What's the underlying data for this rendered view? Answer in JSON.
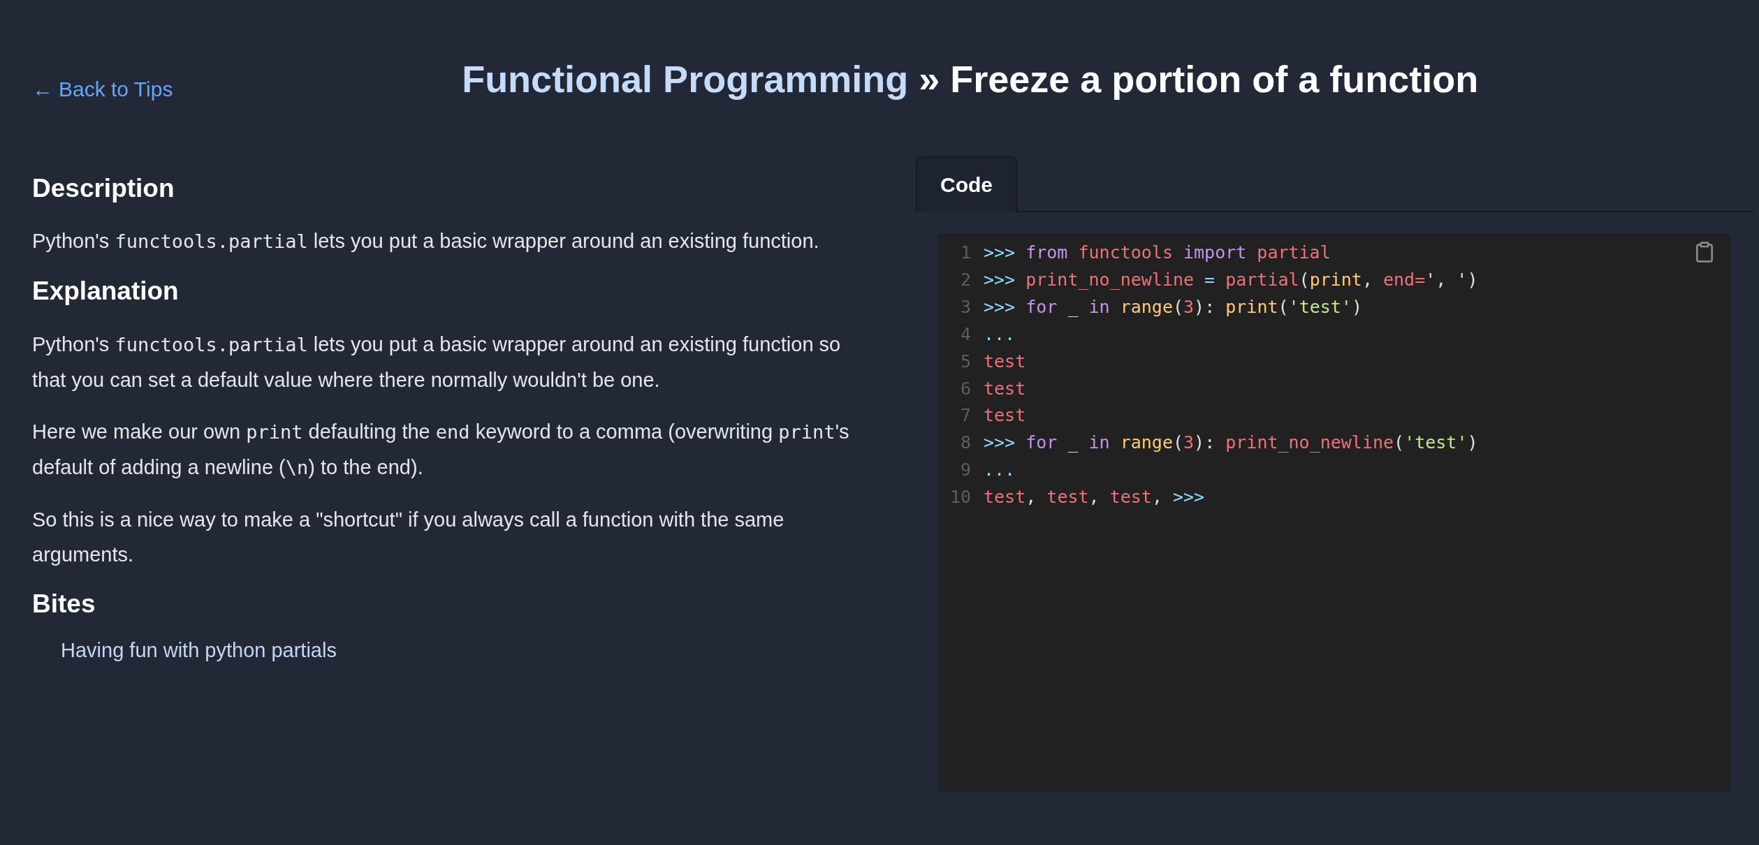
{
  "back_link": {
    "arrow": "←",
    "label": "Back to Tips"
  },
  "title": {
    "category": "Functional Programming",
    "separator": " » ",
    "name": "Freeze a portion of a function"
  },
  "sections": [
    {
      "heading": "Description",
      "paragraphs": [
        [
          {
            "kind": "text",
            "text": "Python's "
          },
          {
            "kind": "code",
            "text": "functools.partial"
          },
          {
            "kind": "text",
            "text": " lets you put a basic wrapper around an existing function."
          }
        ]
      ]
    },
    {
      "heading": "Explanation",
      "paragraphs": [
        [
          {
            "kind": "text",
            "text": "Python's "
          },
          {
            "kind": "code",
            "text": "functools.partial"
          },
          {
            "kind": "text",
            "text": " lets you put a basic wrapper around an existing function so that you can set a default value where there normally wouldn't be one."
          }
        ],
        [
          {
            "kind": "text",
            "text": "Here we make our own "
          },
          {
            "kind": "code",
            "text": "print"
          },
          {
            "kind": "text",
            "text": " defaulting the "
          },
          {
            "kind": "code",
            "text": "end"
          },
          {
            "kind": "text",
            "text": " keyword to a comma (overwriting "
          },
          {
            "kind": "code",
            "text": "print"
          },
          {
            "kind": "text",
            "text": "'s default of adding a newline ("
          },
          {
            "kind": "code",
            "text": "\\n"
          },
          {
            "kind": "text",
            "text": ") to the end)."
          }
        ],
        [
          {
            "kind": "text",
            "text": "So this is a nice way to make a \"shortcut\" if you always call a function with the same arguments."
          }
        ]
      ]
    }
  ],
  "bites": {
    "heading": "Bites",
    "links": [
      "Having fun with python partials"
    ]
  },
  "tabs": [
    {
      "label": "Code",
      "selected": true
    }
  ],
  "code_lines": [
    {
      "n": "1",
      "tokens": [
        {
          "kind": "prompt",
          "text": ">>> "
        },
        {
          "kind": "keyword",
          "text": "from "
        },
        {
          "kind": "name",
          "text": "functools "
        },
        {
          "kind": "keyword",
          "text": "import "
        },
        {
          "kind": "name",
          "text": "partial"
        }
      ]
    },
    {
      "n": "2",
      "tokens": [
        {
          "kind": "prompt",
          "text": ">>> "
        },
        {
          "kind": "name",
          "text": "print_no_newline "
        },
        {
          "kind": "operator",
          "text": "= "
        },
        {
          "kind": "name",
          "text": "partial"
        },
        {
          "kind": "punct",
          "text": "("
        },
        {
          "kind": "builtin",
          "text": "print"
        },
        {
          "kind": "punct",
          "text": ", "
        },
        {
          "kind": "name",
          "text": "end="
        },
        {
          "kind": "punct",
          "text": "', ')"
        }
      ]
    },
    {
      "n": "3",
      "tokens": [
        {
          "kind": "prompt",
          "text": ">>> "
        },
        {
          "kind": "keyword",
          "text": "for "
        },
        {
          "kind": "punct",
          "text": "_ "
        },
        {
          "kind": "keyword",
          "text": "in "
        },
        {
          "kind": "builtin",
          "text": "range"
        },
        {
          "kind": "punct",
          "text": "("
        },
        {
          "kind": "number",
          "text": "3"
        },
        {
          "kind": "punct",
          "text": "): "
        },
        {
          "kind": "builtin",
          "text": "print"
        },
        {
          "kind": "punct",
          "text": "("
        },
        {
          "kind": "string",
          "text": "'test'"
        },
        {
          "kind": "punct",
          "text": ")"
        }
      ]
    },
    {
      "n": "4",
      "tokens": [
        {
          "kind": "prompt",
          "text": "..."
        }
      ]
    },
    {
      "n": "5",
      "tokens": [
        {
          "kind": "output",
          "text": "test"
        }
      ]
    },
    {
      "n": "6",
      "tokens": [
        {
          "kind": "output",
          "text": "test"
        }
      ]
    },
    {
      "n": "7",
      "tokens": [
        {
          "kind": "output",
          "text": "test"
        }
      ]
    },
    {
      "n": "8",
      "tokens": [
        {
          "kind": "prompt",
          "text": ">>> "
        },
        {
          "kind": "keyword",
          "text": "for "
        },
        {
          "kind": "punct",
          "text": "_ "
        },
        {
          "kind": "keyword",
          "text": "in "
        },
        {
          "kind": "builtin",
          "text": "range"
        },
        {
          "kind": "punct",
          "text": "("
        },
        {
          "kind": "number",
          "text": "3"
        },
        {
          "kind": "punct",
          "text": "): "
        },
        {
          "kind": "name",
          "text": "print_no_newline"
        },
        {
          "kind": "punct",
          "text": "("
        },
        {
          "kind": "string",
          "text": "'test'"
        },
        {
          "kind": "punct",
          "text": ")"
        }
      ]
    },
    {
      "n": "9",
      "tokens": [
        {
          "kind": "prompt",
          "text": "..."
        }
      ]
    },
    {
      "n": "10",
      "tokens": [
        {
          "kind": "output",
          "text": "test"
        },
        {
          "kind": "punct",
          "text": ", "
        },
        {
          "kind": "output",
          "text": "test"
        },
        {
          "kind": "punct",
          "text": ", "
        },
        {
          "kind": "output",
          "text": "test"
        },
        {
          "kind": "punct",
          "text": ", "
        },
        {
          "kind": "prompt",
          "text": ">>>"
        }
      ]
    }
  ]
}
